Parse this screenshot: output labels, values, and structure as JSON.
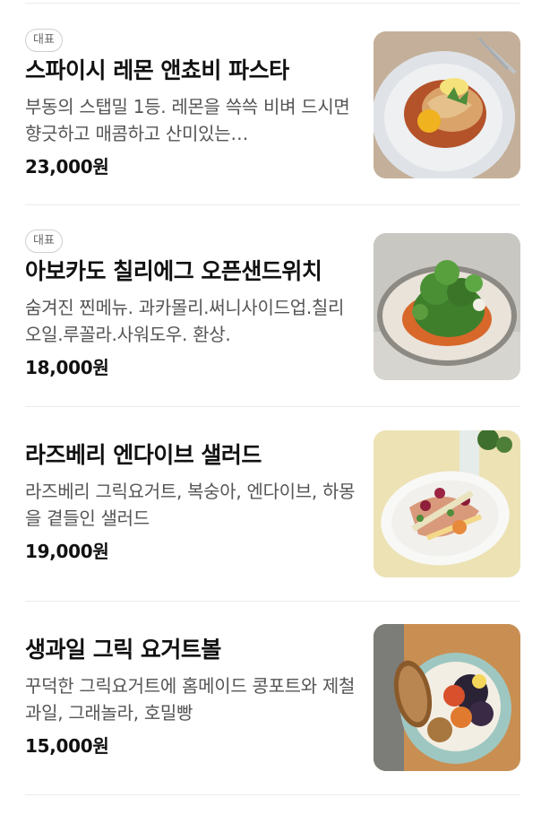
{
  "menu": {
    "items": [
      {
        "badge": "대표",
        "name": "스파이시 레몬 앤쵸비 파스타",
        "description": "부동의 스탭밀 1등. 레몬을 쓱쓱 비벼 드시면 향긋하고 매콤하고 산미있는…",
        "price": "23,000원",
        "image": "spicy-lemon-anchovy-pasta-photo"
      },
      {
        "badge": "대표",
        "name": "아보카도 칠리에그 오픈샌드위치",
        "description": "숨겨진 찐메뉴. 과카몰리.써니사이드업.칠리오일.루꼴라.사워도우. 환상.",
        "price": "18,000원",
        "image": "avocado-chili-egg-sandwich-photo"
      },
      {
        "name": "라즈베리 엔다이브 샐러드",
        "description": "라즈베리 그릭요거트, 복숭아, 엔다이브, 하몽을 곁들인 샐러드",
        "price": "19,000원",
        "image": "raspberry-endive-salad-photo"
      },
      {
        "name": "생과일 그릭 요거트볼",
        "description": "꾸덕한 그릭요거트에 홈메이드 콩포트와 제철과일, 그래놀라, 호밀빵",
        "price": "15,000원",
        "image": "fresh-fruit-greek-yogurt-bowl-photo"
      }
    ]
  }
}
